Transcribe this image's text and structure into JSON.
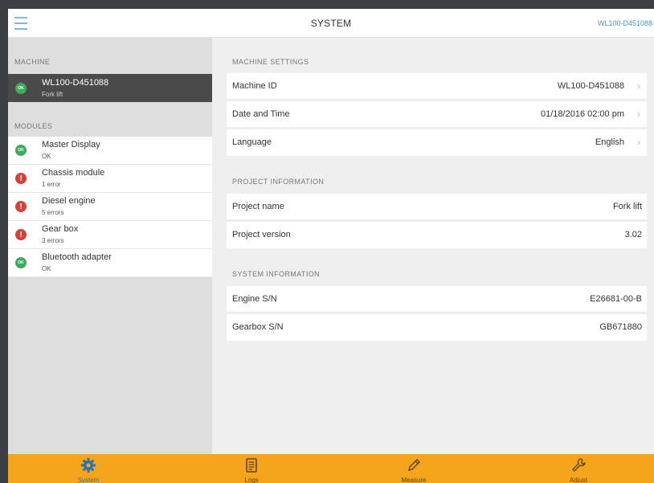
{
  "header": {
    "title": "SYSTEM",
    "machine_id": "WL100-D451088"
  },
  "left": {
    "machine_section": "MACHINE",
    "machine": {
      "name": "WL100-D451088",
      "sub": "Fork lift",
      "status": "ok",
      "status_text": "OK"
    },
    "modules_section": "MODULES",
    "modules": [
      {
        "name": "Master Display",
        "sub": "OK",
        "status": "ok",
        "badge": "OK"
      },
      {
        "name": "Chassis module",
        "sub": "1 error",
        "status": "error",
        "badge": "!"
      },
      {
        "name": "Diesel engine",
        "sub": "5 errors",
        "status": "error",
        "badge": "!"
      },
      {
        "name": "Gear box",
        "sub": "3 errors",
        "status": "error",
        "badge": "!"
      },
      {
        "name": "Bluetooth adapter",
        "sub": "OK",
        "status": "ok",
        "badge": "OK"
      }
    ]
  },
  "right": {
    "machine_settings": {
      "label": "MACHINE SETTINGS",
      "rows": [
        {
          "label": "Machine ID",
          "value": "WL100-D451088"
        },
        {
          "label": "Date and Time",
          "value": "01/18/2016 02:00 pm"
        },
        {
          "label": "Language",
          "value": "English"
        }
      ]
    },
    "project_information": {
      "label": "PROJECT INFORMATION",
      "rows": [
        {
          "label": "Project name",
          "value": "Fork lift"
        },
        {
          "label": "Project version",
          "value": "3.02"
        }
      ]
    },
    "system_information": {
      "label": "SYSTEM INFORMATION",
      "rows": [
        {
          "label": "Engine S/N",
          "value": "E26681-00-B"
        },
        {
          "label": "Gearbox S/N",
          "value": "GB671880"
        }
      ]
    }
  },
  "tabs": [
    {
      "label": "System",
      "icon": "gear-icon",
      "active": true
    },
    {
      "label": "Logs",
      "icon": "log-icon",
      "active": false
    },
    {
      "label": "Measure",
      "icon": "pencil-icon",
      "active": false
    },
    {
      "label": "Adjust",
      "icon": "wrench-icon",
      "active": false
    }
  ],
  "colors": {
    "accent": "#4a90d9",
    "tabbar": "#f4a51c",
    "ok": "#3daa5c",
    "error": "#d9403a",
    "selected_row": "#4a4a4a"
  }
}
